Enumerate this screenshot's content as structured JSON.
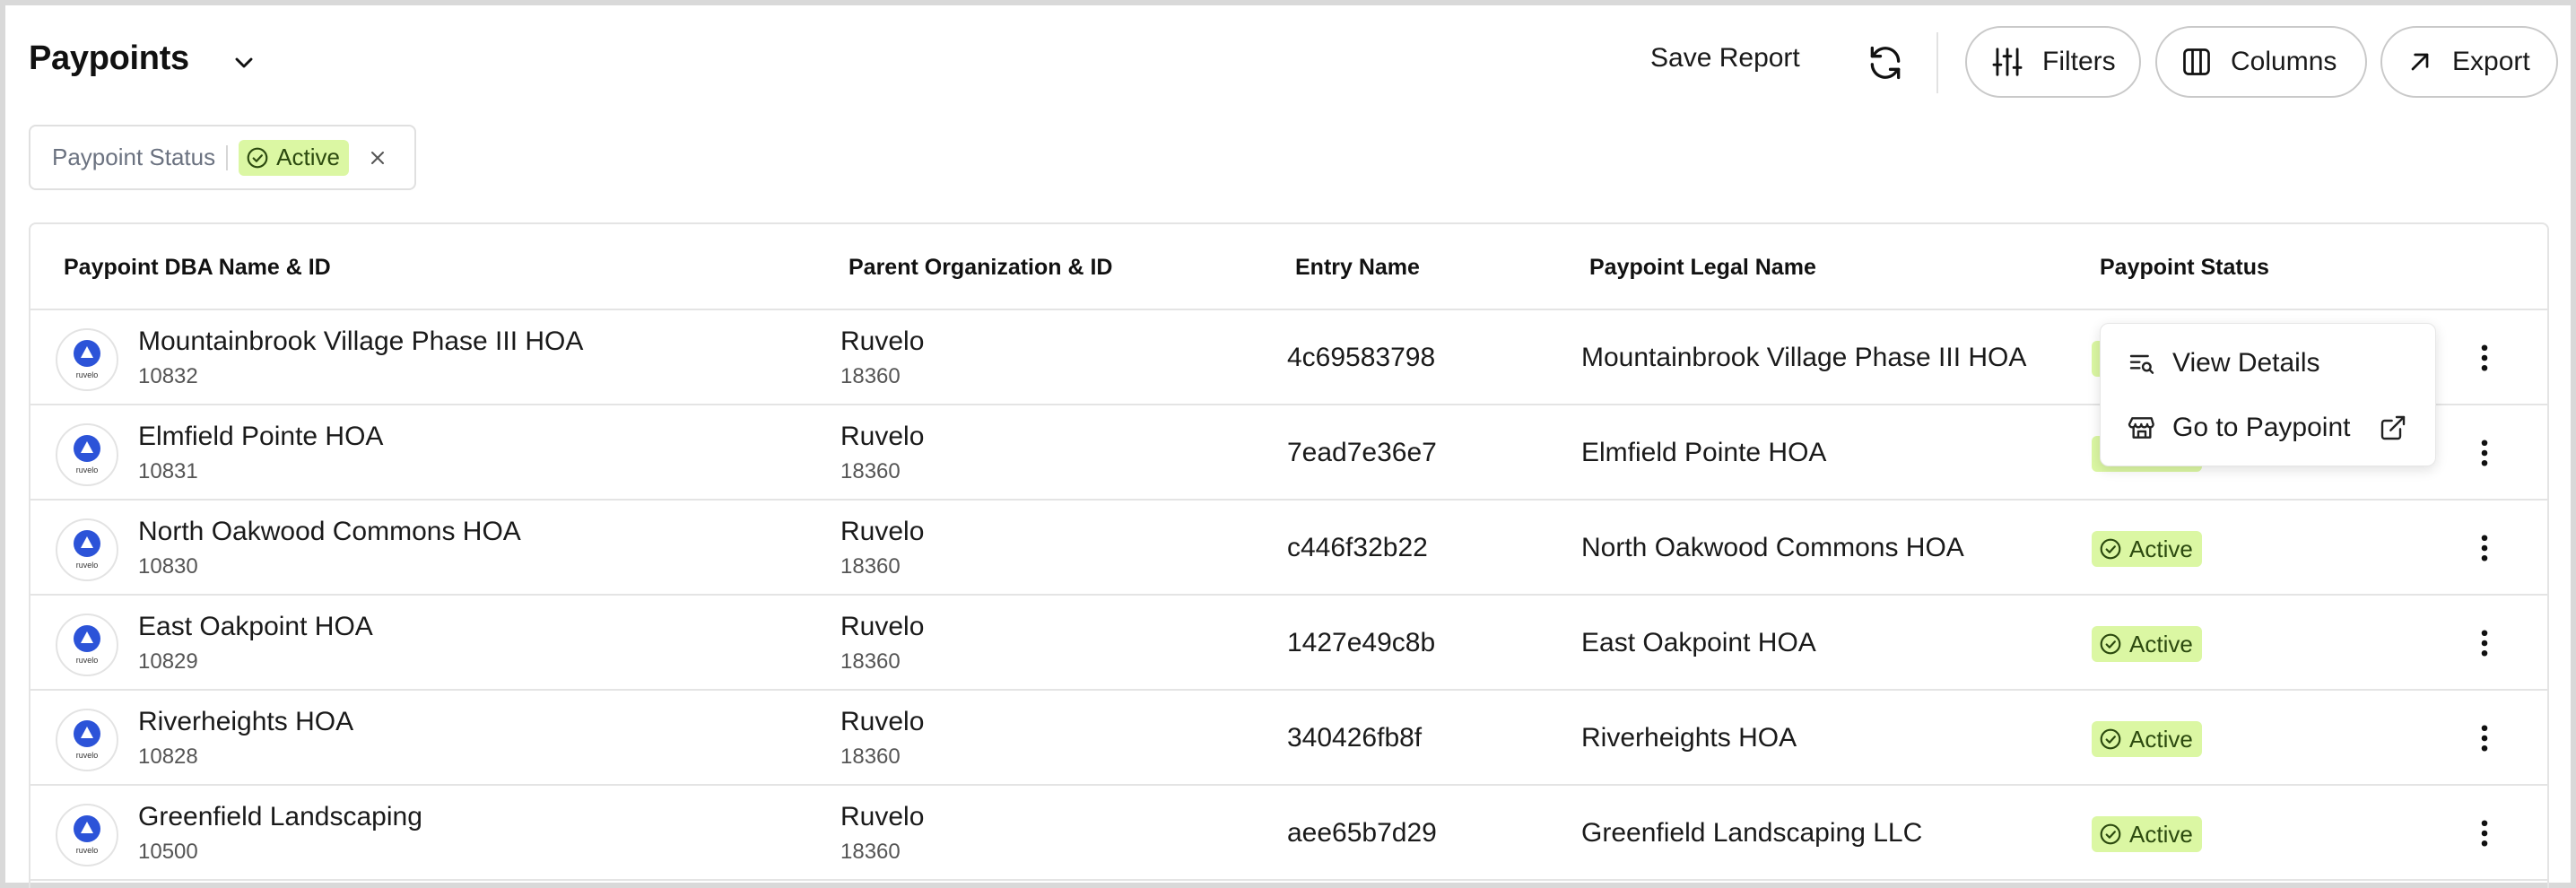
{
  "header": {
    "title": "Paypoints",
    "save_report_label": "Save Report",
    "buttons": {
      "filters": "Filters",
      "columns": "Columns",
      "export": "Export"
    }
  },
  "filter_chip": {
    "label": "Paypoint Status",
    "value": "Active"
  },
  "table": {
    "columns": [
      "Paypoint DBA Name & ID",
      "Parent Organization & ID",
      "Entry Name",
      "Paypoint Legal Name",
      "Paypoint Status"
    ],
    "rows": [
      {
        "dba_name": "Mountainbrook Village Phase III HOA",
        "dba_id": "10832",
        "parent_org": "Ruvelo",
        "parent_id": "18360",
        "entry_name": "4c69583798",
        "legal_name": "Mountainbrook Village Phase III HOA",
        "status": "Active",
        "logo_text": "ruvelo"
      },
      {
        "dba_name": "Elmfield Pointe HOA",
        "dba_id": "10831",
        "parent_org": "Ruvelo",
        "parent_id": "18360",
        "entry_name": "7ead7e36e7",
        "legal_name": "Elmfield Pointe HOA",
        "status": "Active",
        "logo_text": "ruvelo"
      },
      {
        "dba_name": "North Oakwood Commons HOA",
        "dba_id": "10830",
        "parent_org": "Ruvelo",
        "parent_id": "18360",
        "entry_name": "c446f32b22",
        "legal_name": "North Oakwood Commons HOA",
        "status": "Active",
        "logo_text": "ruvelo"
      },
      {
        "dba_name": "East Oakpoint HOA",
        "dba_id": "10829",
        "parent_org": "Ruvelo",
        "parent_id": "18360",
        "entry_name": "1427e49c8b",
        "legal_name": "East Oakpoint HOA",
        "status": "Active",
        "logo_text": "ruvelo"
      },
      {
        "dba_name": "Riverheights HOA",
        "dba_id": "10828",
        "parent_org": "Ruvelo",
        "parent_id": "18360",
        "entry_name": "340426fb8f",
        "legal_name": "Riverheights HOA",
        "status": "Active",
        "logo_text": "ruvelo"
      },
      {
        "dba_name": "Greenfield Landscaping",
        "dba_id": "10500",
        "parent_org": "Ruvelo",
        "parent_id": "18360",
        "entry_name": "aee65b7d29",
        "legal_name": "Greenfield Landscaping LLC",
        "status": "Active",
        "logo_text": "ruvelo"
      }
    ]
  },
  "row_menu": {
    "items": [
      {
        "label": "View Details",
        "icon": "view-details-icon"
      },
      {
        "label": "Go to Paypoint",
        "icon": "storefront-icon"
      }
    ]
  },
  "colors": {
    "badge_bg": "#dbf7a3",
    "badge_text": "#2c4a0f",
    "logo_blue": "#2c53d8",
    "border": "#e4e4e4"
  }
}
